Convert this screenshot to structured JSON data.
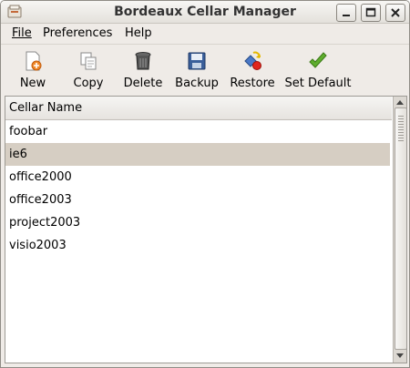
{
  "window": {
    "title": "Bordeaux Cellar Manager"
  },
  "menu": {
    "file": "File",
    "preferences": "Preferences",
    "help": "Help"
  },
  "toolbar": {
    "new": "New",
    "copy": "Copy",
    "delete": "Delete",
    "backup": "Backup",
    "restore": "Restore",
    "set_default": "Set Default"
  },
  "list": {
    "header": "Cellar Name",
    "rows": [
      "foobar",
      "ie6",
      "office2000",
      "office2003",
      "project2003",
      "visio2003"
    ],
    "selected_index": 1
  },
  "colors": {
    "selection": "#d6cec3",
    "background": "#efebe7"
  }
}
